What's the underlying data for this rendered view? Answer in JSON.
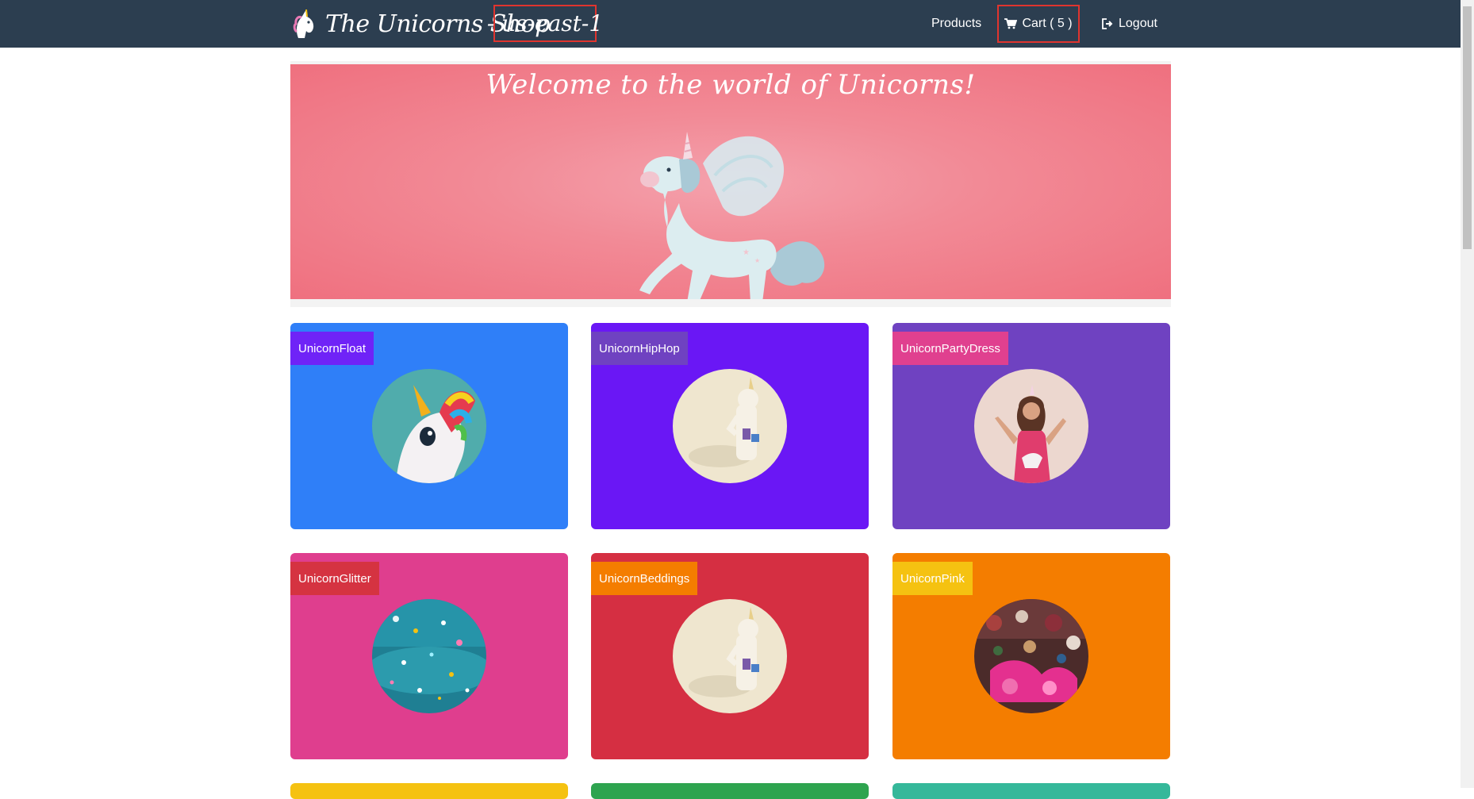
{
  "navbar": {
    "brand": "The Unicorns Shop",
    "region": "- us-east-1",
    "links": {
      "products": "Products",
      "cart": "Cart ( 5 )",
      "logout": "Logout"
    }
  },
  "hero": {
    "title": "Welcome to the world of Unicorns!"
  },
  "products": [
    {
      "name": "UnicornFloat",
      "card_color": "#2f7ff8",
      "label_color": "#6f23f7"
    },
    {
      "name": "UnicornHipHop",
      "card_color": "#6a17f5",
      "label_color": "#6f42c1"
    },
    {
      "name": "UnicornPartyDress",
      "card_color": "#6f42c1",
      "label_color": "#e0408f"
    },
    {
      "name": "UnicornGlitter",
      "card_color": "#df3e8e",
      "label_color": "#d53341"
    },
    {
      "name": "UnicornBeddings",
      "card_color": "#d52f42",
      "label_color": "#f47d00"
    },
    {
      "name": "UnicornPink",
      "card_color": "#f47d00",
      "label_color": "#f5c211"
    }
  ],
  "next_row_colors": [
    "#f5c211",
    "#2ea44f",
    "#35b89a"
  ],
  "colors": {
    "navbar": "#2c3e50",
    "highlight_border": "#e0342e"
  }
}
